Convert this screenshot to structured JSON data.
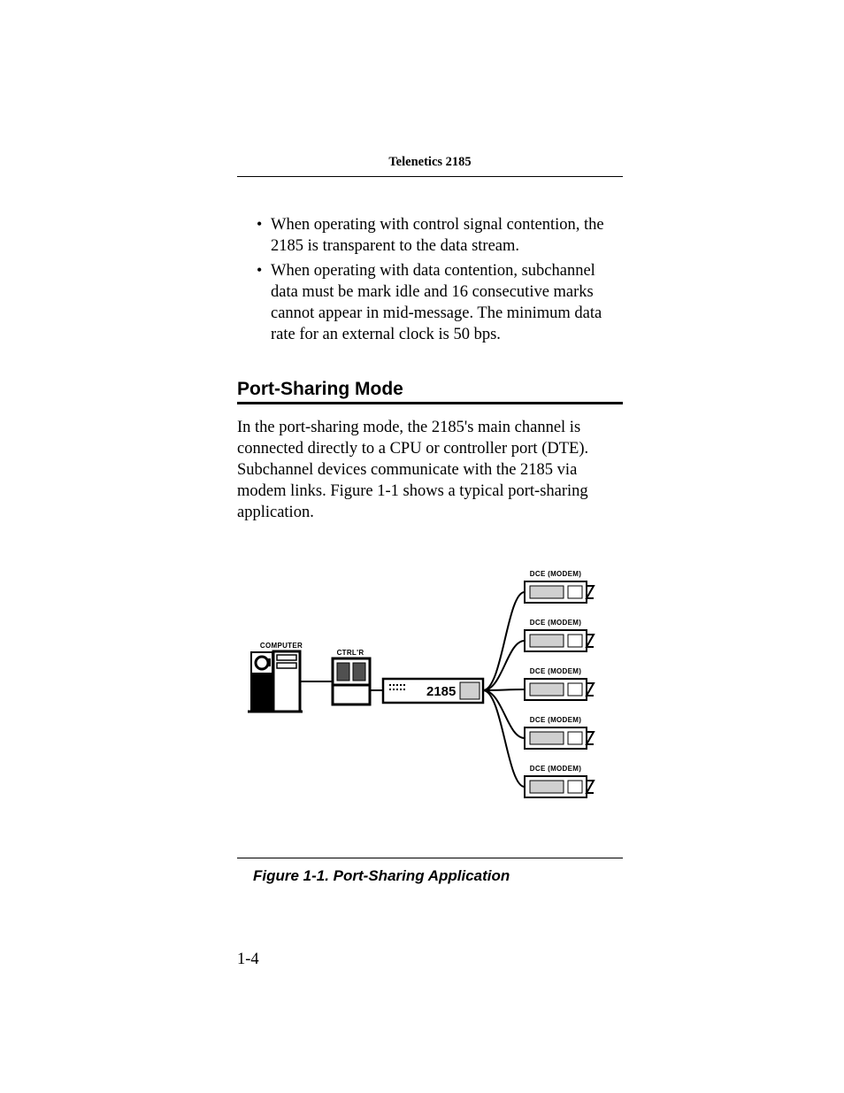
{
  "header": {
    "running_title": "Telenetics 2185"
  },
  "bullets": {
    "items": [
      "When operating with control signal contention, the 2185 is transparent to the data stream.",
      "When operating with data contention, subchannel data must be mark idle and 16 consecutive marks cannot appear in mid-message. The minimum data rate for an external clock is 50 bps."
    ]
  },
  "section": {
    "title": "Port-Sharing Mode",
    "paragraph": "In the port-sharing mode, the 2185's main channel is connected directly to a CPU or controller port (DTE). Subchannel devices communicate with the 2185 via modem links. Figure 1-1 shows a typical port-sharing application."
  },
  "figure": {
    "computer_label": "COMPUTER",
    "controller_label": "CTRL'R",
    "device_label": "2185",
    "modem_label": "DCE (MODEM)",
    "caption": "Figure 1-1. Port-Sharing Application"
  },
  "footer": {
    "page_number": "1-4"
  }
}
